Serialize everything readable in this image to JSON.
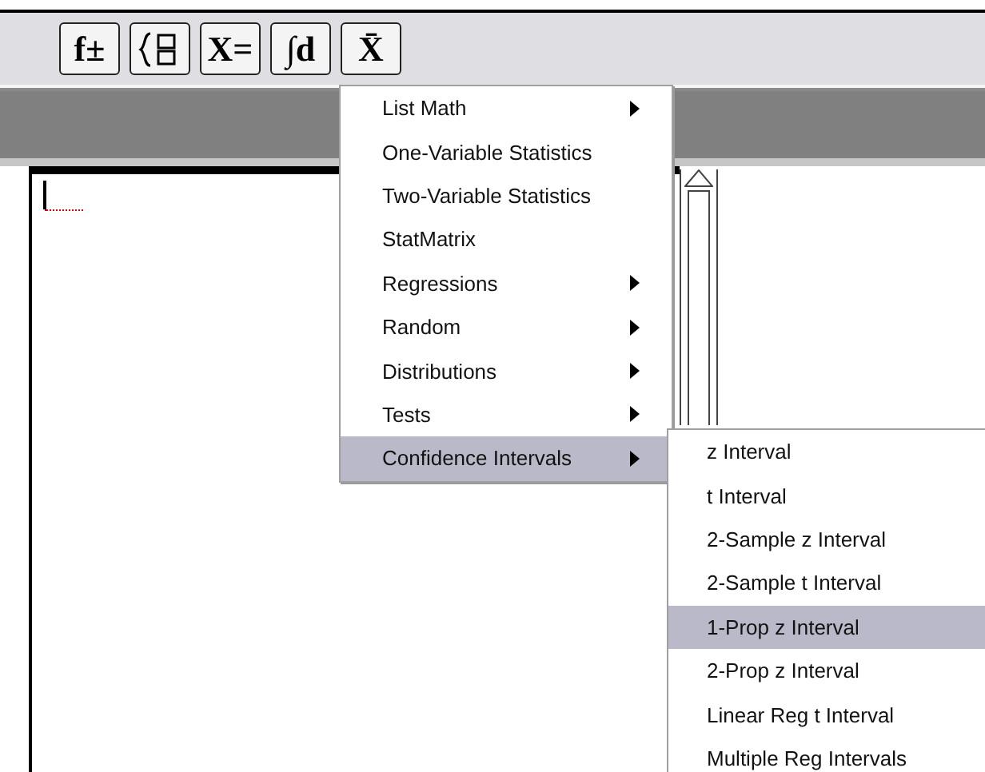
{
  "toolbar": {
    "buttons": [
      {
        "kind": "text",
        "label": "f±"
      },
      {
        "kind": "icon"
      },
      {
        "kind": "text",
        "label": "X="
      },
      {
        "kind": "text",
        "label": "∫d"
      },
      {
        "kind": "text",
        "label": "X̄"
      }
    ]
  },
  "menu": {
    "items": [
      {
        "label": "List Math",
        "submenu": true,
        "selected": false
      },
      {
        "label": "One-Variable Statistics",
        "submenu": false,
        "selected": false
      },
      {
        "label": "Two-Variable Statistics",
        "submenu": false,
        "selected": false
      },
      {
        "label": "StatMatrix",
        "submenu": false,
        "selected": false
      },
      {
        "label": "Regressions",
        "submenu": true,
        "selected": false
      },
      {
        "label": "Random",
        "submenu": true,
        "selected": false
      },
      {
        "label": "Distributions",
        "submenu": true,
        "selected": false
      },
      {
        "label": "Tests",
        "submenu": true,
        "selected": false
      },
      {
        "label": "Confidence Intervals",
        "submenu": true,
        "selected": true
      }
    ]
  },
  "submenu": {
    "items": [
      {
        "label": "z Interval",
        "selected": false
      },
      {
        "label": "t Interval",
        "selected": false
      },
      {
        "label": "2-Sample z Interval",
        "selected": false
      },
      {
        "label": "2-Sample t Interval",
        "selected": false
      },
      {
        "label": "1-Prop z Interval",
        "selected": true
      },
      {
        "label": "2-Prop z Interval",
        "selected": false
      },
      {
        "label": "Linear Reg t Interval",
        "selected": false
      },
      {
        "label": "Multiple Reg Intervals",
        "selected": false
      }
    ]
  }
}
